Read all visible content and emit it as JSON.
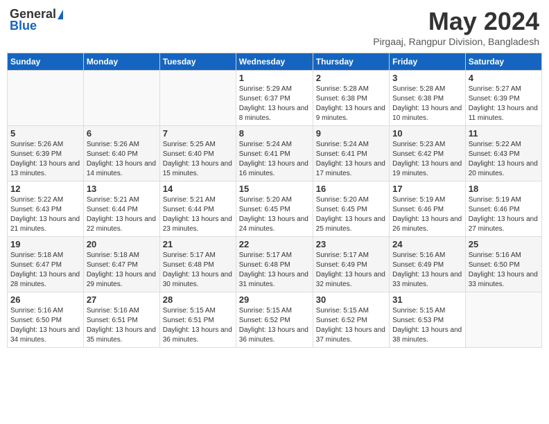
{
  "header": {
    "logo_general": "General",
    "logo_blue": "Blue",
    "month_title": "May 2024",
    "location": "Pirgaaj, Rangpur Division, Bangladesh"
  },
  "days_of_week": [
    "Sunday",
    "Monday",
    "Tuesday",
    "Wednesday",
    "Thursday",
    "Friday",
    "Saturday"
  ],
  "weeks": [
    [
      {
        "num": "",
        "sunrise": "",
        "sunset": "",
        "daylight": ""
      },
      {
        "num": "",
        "sunrise": "",
        "sunset": "",
        "daylight": ""
      },
      {
        "num": "",
        "sunrise": "",
        "sunset": "",
        "daylight": ""
      },
      {
        "num": "1",
        "sunrise": "Sunrise: 5:29 AM",
        "sunset": "Sunset: 6:37 PM",
        "daylight": "Daylight: 13 hours and 8 minutes."
      },
      {
        "num": "2",
        "sunrise": "Sunrise: 5:28 AM",
        "sunset": "Sunset: 6:38 PM",
        "daylight": "Daylight: 13 hours and 9 minutes."
      },
      {
        "num": "3",
        "sunrise": "Sunrise: 5:28 AM",
        "sunset": "Sunset: 6:38 PM",
        "daylight": "Daylight: 13 hours and 10 minutes."
      },
      {
        "num": "4",
        "sunrise": "Sunrise: 5:27 AM",
        "sunset": "Sunset: 6:39 PM",
        "daylight": "Daylight: 13 hours and 11 minutes."
      }
    ],
    [
      {
        "num": "5",
        "sunrise": "Sunrise: 5:26 AM",
        "sunset": "Sunset: 6:39 PM",
        "daylight": "Daylight: 13 hours and 13 minutes."
      },
      {
        "num": "6",
        "sunrise": "Sunrise: 5:26 AM",
        "sunset": "Sunset: 6:40 PM",
        "daylight": "Daylight: 13 hours and 14 minutes."
      },
      {
        "num": "7",
        "sunrise": "Sunrise: 5:25 AM",
        "sunset": "Sunset: 6:40 PM",
        "daylight": "Daylight: 13 hours and 15 minutes."
      },
      {
        "num": "8",
        "sunrise": "Sunrise: 5:24 AM",
        "sunset": "Sunset: 6:41 PM",
        "daylight": "Daylight: 13 hours and 16 minutes."
      },
      {
        "num": "9",
        "sunrise": "Sunrise: 5:24 AM",
        "sunset": "Sunset: 6:41 PM",
        "daylight": "Daylight: 13 hours and 17 minutes."
      },
      {
        "num": "10",
        "sunrise": "Sunrise: 5:23 AM",
        "sunset": "Sunset: 6:42 PM",
        "daylight": "Daylight: 13 hours and 19 minutes."
      },
      {
        "num": "11",
        "sunrise": "Sunrise: 5:22 AM",
        "sunset": "Sunset: 6:43 PM",
        "daylight": "Daylight: 13 hours and 20 minutes."
      }
    ],
    [
      {
        "num": "12",
        "sunrise": "Sunrise: 5:22 AM",
        "sunset": "Sunset: 6:43 PM",
        "daylight": "Daylight: 13 hours and 21 minutes."
      },
      {
        "num": "13",
        "sunrise": "Sunrise: 5:21 AM",
        "sunset": "Sunset: 6:44 PM",
        "daylight": "Daylight: 13 hours and 22 minutes."
      },
      {
        "num": "14",
        "sunrise": "Sunrise: 5:21 AM",
        "sunset": "Sunset: 6:44 PM",
        "daylight": "Daylight: 13 hours and 23 minutes."
      },
      {
        "num": "15",
        "sunrise": "Sunrise: 5:20 AM",
        "sunset": "Sunset: 6:45 PM",
        "daylight": "Daylight: 13 hours and 24 minutes."
      },
      {
        "num": "16",
        "sunrise": "Sunrise: 5:20 AM",
        "sunset": "Sunset: 6:45 PM",
        "daylight": "Daylight: 13 hours and 25 minutes."
      },
      {
        "num": "17",
        "sunrise": "Sunrise: 5:19 AM",
        "sunset": "Sunset: 6:46 PM",
        "daylight": "Daylight: 13 hours and 26 minutes."
      },
      {
        "num": "18",
        "sunrise": "Sunrise: 5:19 AM",
        "sunset": "Sunset: 6:46 PM",
        "daylight": "Daylight: 13 hours and 27 minutes."
      }
    ],
    [
      {
        "num": "19",
        "sunrise": "Sunrise: 5:18 AM",
        "sunset": "Sunset: 6:47 PM",
        "daylight": "Daylight: 13 hours and 28 minutes."
      },
      {
        "num": "20",
        "sunrise": "Sunrise: 5:18 AM",
        "sunset": "Sunset: 6:47 PM",
        "daylight": "Daylight: 13 hours and 29 minutes."
      },
      {
        "num": "21",
        "sunrise": "Sunrise: 5:17 AM",
        "sunset": "Sunset: 6:48 PM",
        "daylight": "Daylight: 13 hours and 30 minutes."
      },
      {
        "num": "22",
        "sunrise": "Sunrise: 5:17 AM",
        "sunset": "Sunset: 6:48 PM",
        "daylight": "Daylight: 13 hours and 31 minutes."
      },
      {
        "num": "23",
        "sunrise": "Sunrise: 5:17 AM",
        "sunset": "Sunset: 6:49 PM",
        "daylight": "Daylight: 13 hours and 32 minutes."
      },
      {
        "num": "24",
        "sunrise": "Sunrise: 5:16 AM",
        "sunset": "Sunset: 6:49 PM",
        "daylight": "Daylight: 13 hours and 33 minutes."
      },
      {
        "num": "25",
        "sunrise": "Sunrise: 5:16 AM",
        "sunset": "Sunset: 6:50 PM",
        "daylight": "Daylight: 13 hours and 33 minutes."
      }
    ],
    [
      {
        "num": "26",
        "sunrise": "Sunrise: 5:16 AM",
        "sunset": "Sunset: 6:50 PM",
        "daylight": "Daylight: 13 hours and 34 minutes."
      },
      {
        "num": "27",
        "sunrise": "Sunrise: 5:16 AM",
        "sunset": "Sunset: 6:51 PM",
        "daylight": "Daylight: 13 hours and 35 minutes."
      },
      {
        "num": "28",
        "sunrise": "Sunrise: 5:15 AM",
        "sunset": "Sunset: 6:51 PM",
        "daylight": "Daylight: 13 hours and 36 minutes."
      },
      {
        "num": "29",
        "sunrise": "Sunrise: 5:15 AM",
        "sunset": "Sunset: 6:52 PM",
        "daylight": "Daylight: 13 hours and 36 minutes."
      },
      {
        "num": "30",
        "sunrise": "Sunrise: 5:15 AM",
        "sunset": "Sunset: 6:52 PM",
        "daylight": "Daylight: 13 hours and 37 minutes."
      },
      {
        "num": "31",
        "sunrise": "Sunrise: 5:15 AM",
        "sunset": "Sunset: 6:53 PM",
        "daylight": "Daylight: 13 hours and 38 minutes."
      },
      {
        "num": "",
        "sunrise": "",
        "sunset": "",
        "daylight": ""
      }
    ]
  ]
}
